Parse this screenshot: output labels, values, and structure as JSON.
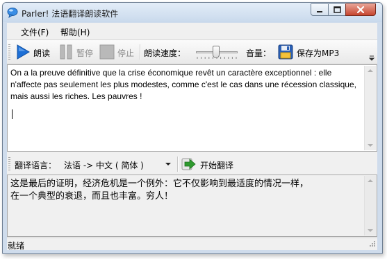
{
  "window": {
    "title": "Parler! 法语翻译朗读软件"
  },
  "menu": {
    "file": "文件(F)",
    "help": "帮助(H)"
  },
  "toolbar": {
    "read": "朗读",
    "pause": "暂停",
    "stop": "停止",
    "speed_label": "朗读速度：",
    "volume_label": "音量：",
    "save_mp3": "保存为MP3",
    "speed_value": 0.48
  },
  "source_text": "On a la preuve définitive que la crise économique revêt un caractère exceptionnel : elle n'affecte pas seulement les plus modestes, comme c'est le cas dans une récession classique, mais aussi les riches. Les pauvres !",
  "translation": {
    "language_label": "翻译语言：",
    "selected_language": "法语 -> 中文 ( 简体 )",
    "translate_button": "开始翻译"
  },
  "result_text": "这是最后的证明，经济危机是一个例外：它不仅影响到最适度的情况一样，\n在一个典型的衰退，而且也丰富。穷人！",
  "status": {
    "text": "就绪"
  },
  "colors": {
    "play_blue": "#1d6fd6",
    "translate_green": "#2e9a2e",
    "close_red": "#c6452f"
  }
}
